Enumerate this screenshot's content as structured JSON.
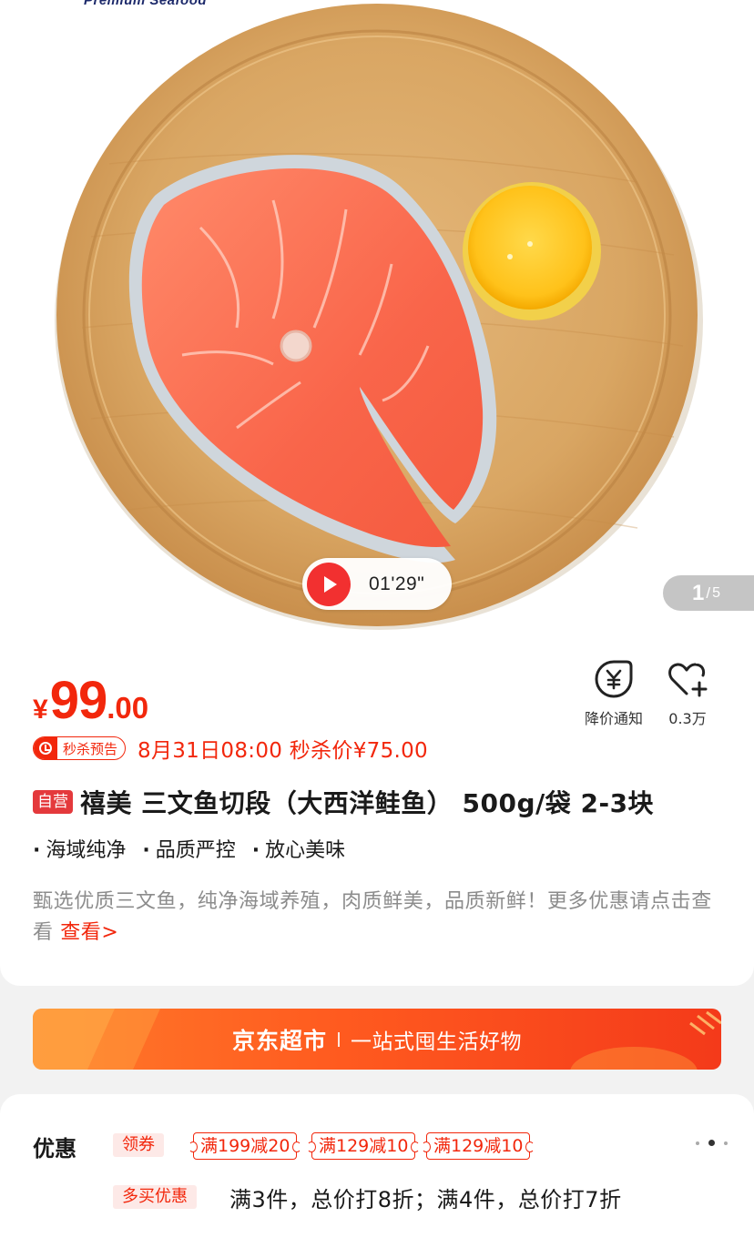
{
  "hero": {
    "brand_text": "Premium Seafood",
    "video_duration": "01'29\"",
    "page_current": "1",
    "page_separator": "/",
    "page_total": "5"
  },
  "product": {
    "price_symbol": "¥",
    "price_integer": "99",
    "price_decimal": ".00",
    "price_notify_label": "降价通知",
    "favorite_count": "0.3万",
    "seckill_badge": "秒杀预告",
    "seckill_text": "8月31日08:00 秒杀价¥75.00",
    "self_operated_tag": "自营",
    "title": "禧美 三文鱼切段（大西洋鲑鱼） 500g/袋 2-3块",
    "features": [
      "海域纯净",
      "品质严控",
      "放心美味"
    ],
    "description": "甄选优质三文鱼，纯净海域养殖，肉质鲜美，品质新鲜！更多优惠请点击查看",
    "description_link": "查看>"
  },
  "banner": {
    "title": "京东超市",
    "subtitle": "一站式囤生活好物"
  },
  "promotions": {
    "heading": "优惠",
    "coupon_tag": "领券",
    "coupons": [
      "满199减20",
      "满129减10",
      "满129减10"
    ],
    "multi_buy_tag": "多买优惠",
    "multi_buy_text": "满3件，总价打8折；满4件，总价打7折"
  },
  "colors": {
    "accent_red": "#f2270c",
    "self_tag_red": "#e4393c",
    "banner_orange": "#ff5a1f"
  },
  "icons": [
    "play-icon",
    "yen-bell-icon",
    "heart-plus-icon",
    "alarm-clock-icon",
    "more-dots-icon"
  ]
}
